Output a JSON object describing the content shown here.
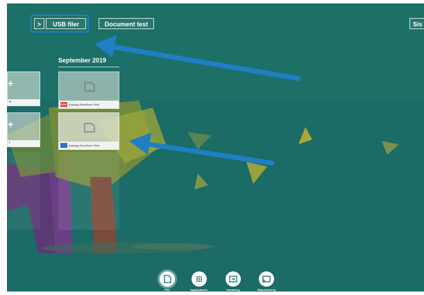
{
  "toolbar": {
    "crumb_chevron": ">",
    "crumb_usb": "USB filer",
    "crumb_document": "Document test",
    "top_right_label": "Sis"
  },
  "main": {
    "month_title": "September 2019",
    "tiles": [
      {
        "badge": "PDF",
        "badge_color": "#e0443a",
        "caption": "Applagg Stackholm Stad"
      },
      {
        "badge": "",
        "badge_color": "#2a6fd6",
        "caption": "Applagg Stockholm Stad"
      }
    ],
    "side_tiles": [
      {
        "plus": "+",
        "caption": "a"
      },
      {
        "plus": "+",
        "caption": "t"
      }
    ]
  },
  "dock": {
    "items": [
      {
        "label": "Filer",
        "icon": "file-icon"
      },
      {
        "label": "Applikationer",
        "icon": "apps-grid-icon"
      },
      {
        "label": "Inmatning",
        "icon": "input-icon"
      },
      {
        "label": "Skärmdelning",
        "icon": "cast-icon"
      }
    ]
  },
  "colors": {
    "background": "#1b6b66",
    "arrow": "#1f7fc4",
    "highlight": "#1f7fc4"
  }
}
